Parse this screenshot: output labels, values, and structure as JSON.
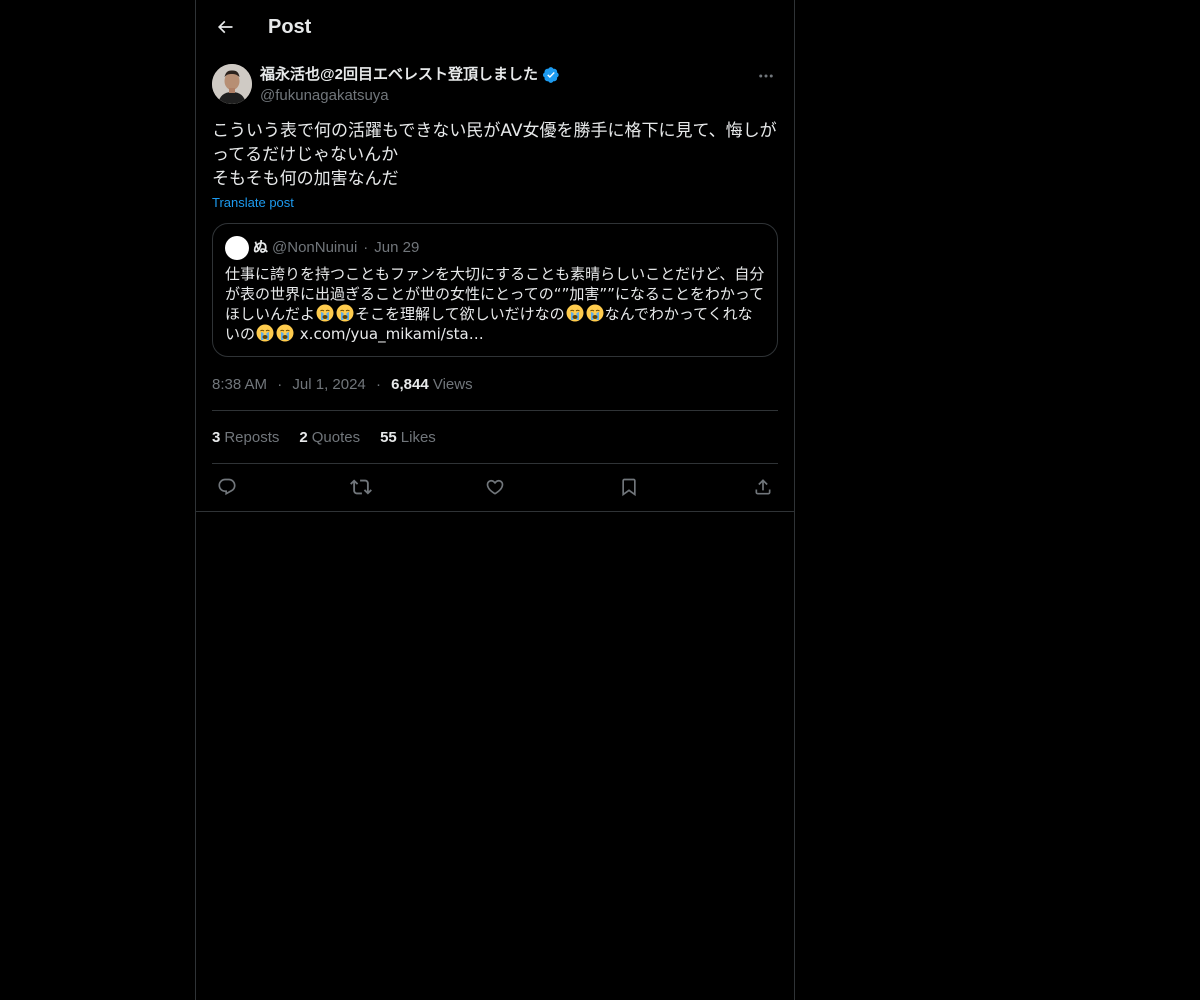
{
  "header": {
    "title": "Post",
    "back_icon": "arrow-left-icon"
  },
  "author": {
    "display_name": "福永活也@2回目エベレスト登頂しました",
    "handle": "@fukunagakatsuya",
    "verified": true,
    "verified_color": "#1d9bf0"
  },
  "post": {
    "text": "こういう表で何の活躍もできない民がAV女優を勝手に格下に見て、悔しがってるだけじゃないんか\nそもそも何の加害なんだ",
    "translate_label": "Translate post"
  },
  "quote": {
    "name": "ぬ",
    "handle": "@NonNuinui",
    "separator": "·",
    "date": "Jun 29",
    "text_part1": "仕事に誇りを持つこともファンを大切にすることも素晴らしいことだけど、自分が表の世界に出過ぎることが世の女性にとっての“”加害””になることをわかってほしいんだよ",
    "text_part2": "そこを理解して欲しいだけなの",
    "text_part3": "なんでわかってくれないの",
    "link": "x.com/yua_mikami/sta…",
    "emoji": "loudly-crying-face"
  },
  "meta": {
    "time": "8:38 AM",
    "separator": "·",
    "date": "Jul 1, 2024",
    "views_count": "6,844",
    "views_label": "Views"
  },
  "stats": {
    "reposts_count": "3",
    "reposts_label": "Reposts",
    "quotes_count": "2",
    "quotes_label": "Quotes",
    "likes_count": "55",
    "likes_label": "Likes"
  },
  "colors": {
    "background": "#000000",
    "text_primary": "#e7e9ea",
    "text_secondary": "#71767b",
    "accent": "#1d9bf0",
    "border": "#2f3336"
  }
}
